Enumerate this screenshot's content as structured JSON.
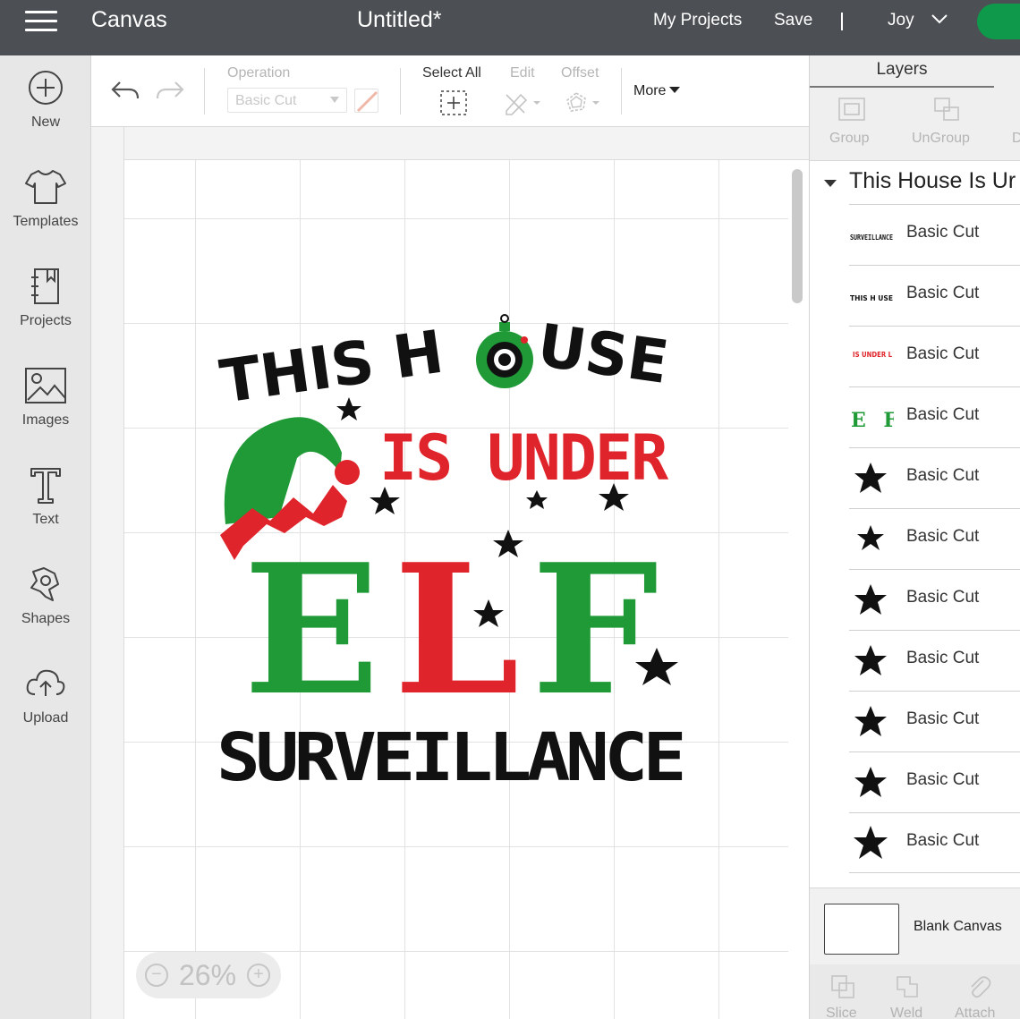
{
  "header": {
    "app_name": "Canvas",
    "doc_title": "Untitled*",
    "nav_projects": "My Projects",
    "nav_save": "Save",
    "separator": "|",
    "user_name": "Joy"
  },
  "sidebar": {
    "items": [
      {
        "label": "New",
        "icon": "plus-circle-icon"
      },
      {
        "label": "Templates",
        "icon": "tshirt-icon"
      },
      {
        "label": "Projects",
        "icon": "notebook-icon"
      },
      {
        "label": "Images",
        "icon": "image-icon"
      },
      {
        "label": "Text",
        "icon": "text-t-icon"
      },
      {
        "label": "Shapes",
        "icon": "shapes-icon"
      },
      {
        "label": "Upload",
        "icon": "cloud-upload-icon"
      }
    ]
  },
  "toolbar": {
    "operation_label": "Operation",
    "operation_value": "Basic Cut",
    "select_all_label": "Select All",
    "edit_label": "Edit",
    "offset_label": "Offset",
    "more_label": "More"
  },
  "canvas": {
    "zoom_value": "26%",
    "zoom_minus": "−",
    "zoom_plus": "+",
    "design": {
      "line1": "THIS H",
      "line1b": "USE",
      "line2": "IS UNDER",
      "line3": [
        "E",
        "L",
        "F"
      ],
      "line4": "SURVEILLANCE"
    },
    "colors": {
      "black": "#111111",
      "red": "#e0242b",
      "green": "#1f9a37"
    }
  },
  "layers_panel": {
    "tab_label": "Layers",
    "tools": [
      "Group",
      "UnGroup",
      "D"
    ],
    "group_title": "This House Is Ur",
    "layers": [
      {
        "thumb": "SURVEILLANCE",
        "label": "Basic Cut"
      },
      {
        "thumb": "THIS H USE",
        "label": "Basic Cut"
      },
      {
        "thumb": "IS UNDER L",
        "label": "Basic Cut"
      },
      {
        "thumb": "E F",
        "label": "Basic Cut"
      },
      {
        "thumb": "star",
        "label": "Basic Cut"
      },
      {
        "thumb": "star",
        "label": "Basic Cut"
      },
      {
        "thumb": "star",
        "label": "Basic Cut"
      },
      {
        "thumb": "star",
        "label": "Basic Cut"
      },
      {
        "thumb": "star",
        "label": "Basic Cut"
      },
      {
        "thumb": "star",
        "label": "Basic Cut"
      },
      {
        "thumb": "star",
        "label": "Basic Cut"
      }
    ],
    "blank_canvas_label": "Blank Canvas",
    "bottom_tools": [
      "Slice",
      "Weld",
      "Attach"
    ]
  }
}
